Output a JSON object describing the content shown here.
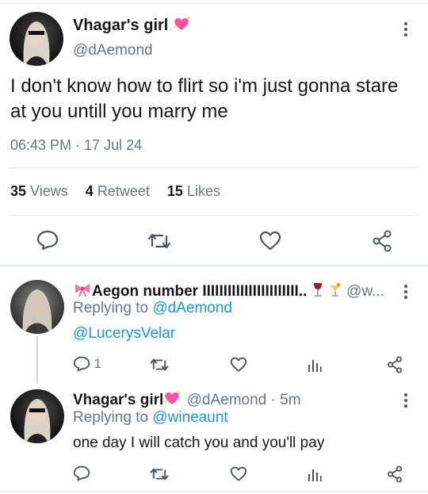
{
  "main_tweet": {
    "display_name": "Vhagar's girl",
    "handle": "@dAemond",
    "text": "I don't know how to flirt so i'm just gonna stare at you untill you marry me",
    "timestamp": "06:43 PM · 17 Jul 24",
    "stats": {
      "views_count": "35",
      "views_label": "Views",
      "retweets_count": "4",
      "retweets_label": "Retweet",
      "likes_count": "15",
      "likes_label": "Likes"
    },
    "actions": [
      "reply-icon",
      "retweet-icon",
      "like-icon",
      "share-icon"
    ]
  },
  "replies": [
    {
      "display_name": "Aegon number IIIIIIIIIIIIIIIIIIIIIII..",
      "handle": "@w...",
      "replying_label": "Replying to",
      "replying_to": "@dAemond",
      "text": "@LucerysVelar",
      "reply_count": "1"
    },
    {
      "display_name": "Vhagar's girl",
      "handle": "@dAemond",
      "time": "· 5m",
      "replying_label": "Replying to",
      "replying_to": "@wineaunt",
      "text": "one day I will catch you and you'll pay"
    }
  ],
  "colors": {
    "link": "#1b95e0",
    "muted": "#657786",
    "divider": "#e1e8ed",
    "heart": "#e0245e"
  }
}
